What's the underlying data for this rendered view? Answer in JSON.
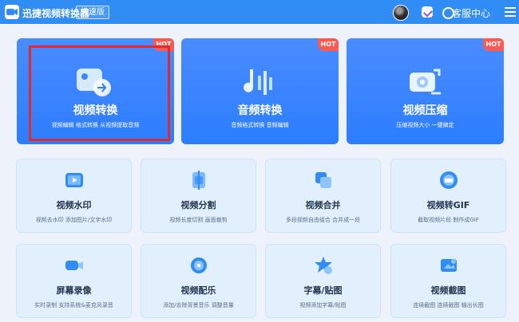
{
  "titlebar": {
    "app_name": "迅捷视频转换器",
    "edition": "极速版",
    "support_label": "客服中心"
  },
  "large_cards": [
    {
      "title": "视频转换",
      "desc": "视频编辑 格式转换 从视频提取音频",
      "hot": "HOT"
    },
    {
      "title": "音频转换",
      "desc": "音频格式转换 音频编辑",
      "hot": "HOT"
    },
    {
      "title": "视频压缩",
      "desc": "压缩视频大小 一键搞定",
      "hot": "HOT"
    }
  ],
  "small_cards": [
    {
      "title": "视频水印",
      "desc": "视频去水印 添加图片/文字水印"
    },
    {
      "title": "视频分割",
      "desc": "视频长度切割 画面裁剪"
    },
    {
      "title": "视频合并",
      "desc": "多段视频自由组合 合并成一段"
    },
    {
      "title": "视频转GIF",
      "desc": "截取视频片段 制作成GIF"
    },
    {
      "title": "屏幕录像",
      "desc": "实时录制 支持系统&麦克风录音"
    },
    {
      "title": "视频配乐",
      "desc": "添加/去除背景音乐 调整音量"
    },
    {
      "title": "字幕/贴图",
      "desc": "视频添加字幕/贴图"
    },
    {
      "title": "视频截图",
      "desc": "连续截图 连续截图 输出长图"
    }
  ],
  "colors": {
    "titlebar": "#2f8df5",
    "accent": "#2c7dff",
    "hot": "#ff5a52",
    "selection": "#e12b2b"
  }
}
